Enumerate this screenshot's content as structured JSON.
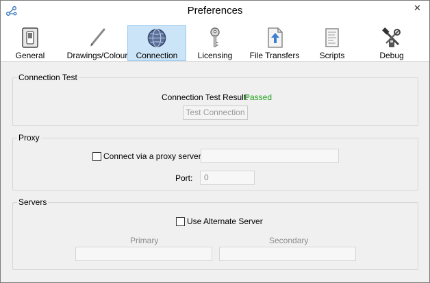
{
  "window": {
    "title": "Preferences"
  },
  "icons": {
    "app": "share-icon",
    "close": "close-icon"
  },
  "tabs": [
    {
      "label": "General",
      "icon": "switch-icon"
    },
    {
      "label": "Drawings/Colour",
      "icon": "pen-icon"
    },
    {
      "label": "Connection",
      "icon": "globe-icon",
      "active": true
    },
    {
      "label": "Licensing",
      "icon": "key-icon"
    },
    {
      "label": "File Transfers",
      "icon": "file-upload-icon"
    },
    {
      "label": "Scripts",
      "icon": "script-icon"
    },
    {
      "label": "Debug",
      "icon": "tools-icon"
    }
  ],
  "connection_test": {
    "title": "Connection Test",
    "result_label": "Connection Test Result:",
    "result_value": "Passed",
    "button_label": "Test Connection"
  },
  "proxy": {
    "title": "Proxy",
    "checkbox_label": "Connect via a proxy server:",
    "checked": false,
    "server_value": "",
    "port_label": "Port:",
    "port_value": "0"
  },
  "servers": {
    "title": "Servers",
    "checkbox_label": "Use Alternate Server",
    "checked": false,
    "primary_label": "Primary",
    "primary_value": "",
    "secondary_label": "Secondary",
    "secondary_value": ""
  },
  "colors": {
    "passed": "#1ea018",
    "active_tab": "#cce4f7"
  }
}
